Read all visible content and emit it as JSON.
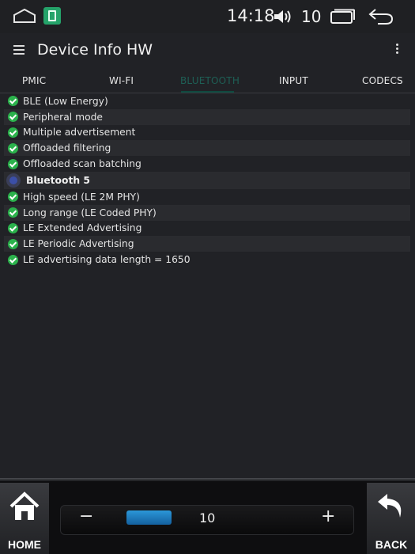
{
  "status_bar": {
    "time": "14:18",
    "volume": "10",
    "icons": [
      "home-outline-icon",
      "app-icon",
      "volume-icon",
      "recents-icon",
      "back-arrow-icon"
    ]
  },
  "app_bar": {
    "title": "Device Info HW",
    "icons": [
      "menu-icon",
      "overflow-icon"
    ]
  },
  "tabs": [
    {
      "label": "PMIC"
    },
    {
      "label": "WI-FI"
    },
    {
      "label": "BLUETOOTH",
      "active": true
    },
    {
      "label": "INPUT"
    },
    {
      "label": "CODECS"
    }
  ],
  "features": [
    {
      "label": "BLE (Low Energy)"
    },
    {
      "label": "Peripheral mode"
    },
    {
      "label": "Multiple advertisement"
    },
    {
      "label": "Offloaded filtering"
    },
    {
      "label": "Offloaded scan batching"
    }
  ],
  "section": {
    "title": "Bluetooth 5",
    "icon": "bluetooth-icon"
  },
  "bt5_features": [
    {
      "label": "High speed (LE 2M PHY)"
    },
    {
      "label": "Long range (LE Coded PHY)"
    },
    {
      "label": "LE Extended Advertising"
    },
    {
      "label": "LE Periodic Advertising"
    },
    {
      "label": "LE advertising data length = 1650"
    }
  ],
  "bottom_bar": {
    "home_label": "HOME",
    "back_label": "BACK",
    "volume_minus": "−",
    "volume_plus": "+",
    "volume_value": "10",
    "slider_color": "#2b97d8"
  },
  "colors": {
    "background": "#212226",
    "check": "#2bb24c",
    "active_tab": "#1e5f55"
  }
}
